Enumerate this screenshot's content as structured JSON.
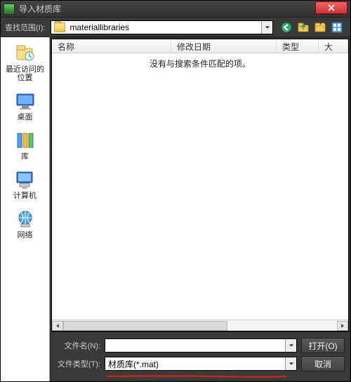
{
  "titlebar": {
    "title": "导入材质库"
  },
  "toolbar": {
    "lookin_label": "查找范围(I):",
    "path_text": "materiallibraries",
    "icons": {
      "back": "back-icon",
      "up": "up-icon",
      "newfolder": "newfolder-icon",
      "views": "views-icon"
    }
  },
  "sidebar": {
    "items": [
      {
        "key": "recent",
        "label": "最近访问的位置"
      },
      {
        "key": "desktop",
        "label": "桌面"
      },
      {
        "key": "libraries",
        "label": "库"
      },
      {
        "key": "computer",
        "label": "计算机"
      },
      {
        "key": "network",
        "label": "网络"
      }
    ]
  },
  "listview": {
    "columns": {
      "name": "名称",
      "date": "修改日期",
      "type": "类型",
      "size": "大"
    },
    "empty_message": "没有与搜索条件匹配的项。"
  },
  "bottom": {
    "filename_label": "文件名(N):",
    "filename_value": "",
    "filetype_label": "文件类型(T):",
    "filetype_value": "材质库(*.mat)",
    "open_label": "打开(O)",
    "cancel_label": "取消"
  }
}
